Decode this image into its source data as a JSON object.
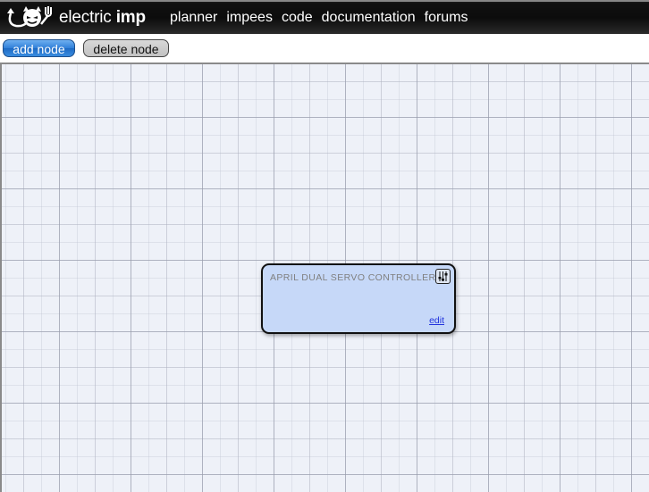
{
  "header": {
    "logo_icon": "imp-devil-icon",
    "brand_light": "electric",
    "brand_bold": "imp",
    "nav": [
      {
        "label": "planner"
      },
      {
        "label": "impees"
      },
      {
        "label": "code"
      },
      {
        "label": "documentation"
      },
      {
        "label": "forums"
      }
    ]
  },
  "toolbar": {
    "add_label": "add node",
    "delete_label": "delete node"
  },
  "canvas": {
    "nodes": [
      {
        "title": "APRIL DUAL SERVO CONTROLLER",
        "settings_icon": "sliders-icon",
        "edit_label": "edit",
        "color": "#c6d8f8"
      }
    ]
  }
}
